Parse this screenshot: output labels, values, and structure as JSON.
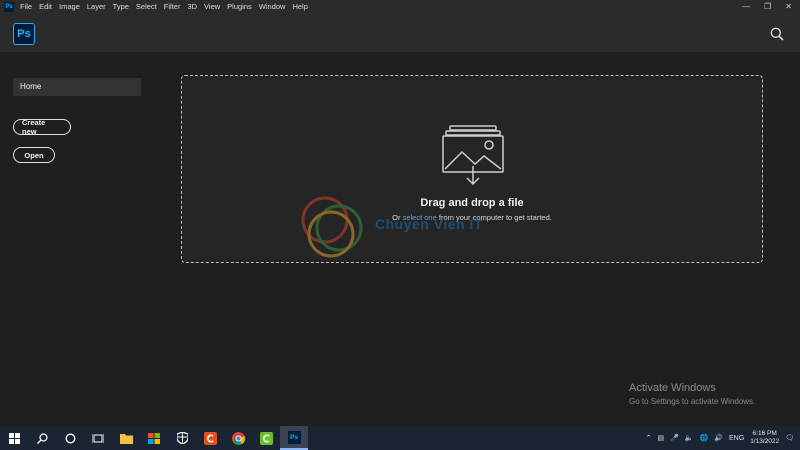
{
  "menubar": {
    "logo": "Ps",
    "items": [
      "File",
      "Edit",
      "Image",
      "Layer",
      "Type",
      "Select",
      "Filter",
      "3D",
      "View",
      "Plugins",
      "Window",
      "Help"
    ]
  },
  "header": {
    "logo": "Ps",
    "search_icon": "search-icon"
  },
  "sidebar": {
    "home_label": "Home",
    "create_label": "Create new",
    "open_label": "Open"
  },
  "dropzone": {
    "title": "Drag and drop a file",
    "sub_prefix": "Or ",
    "sub_link": "select one",
    "sub_suffix": " from your computer to get started."
  },
  "watermark": {
    "text": "Chuyen Vien IT"
  },
  "activation": {
    "title": "Activate Windows",
    "subtitle": "Go to Settings to activate Windows."
  },
  "taskbar": {
    "ps_label": "Ps",
    "language": "ENG",
    "time": "6:16 PM",
    "date": "1/13/2022"
  },
  "colors": {
    "accent": "#31a8ff",
    "link": "#5aa0ff",
    "background": "#1f1f1f"
  }
}
